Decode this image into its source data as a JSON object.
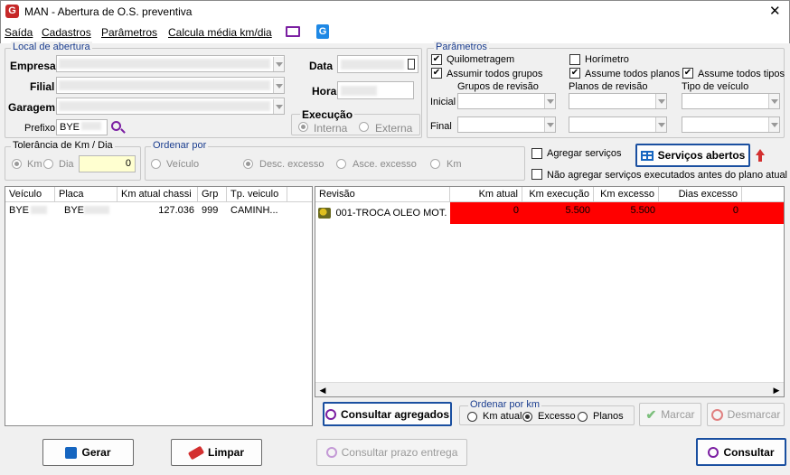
{
  "window": {
    "title": "MAN - Abertura de O.S. preventiva",
    "close": "✕"
  },
  "menu": {
    "items": [
      "Saída",
      "Cadastros",
      "Parâmetros",
      "Calcula média km/dia"
    ]
  },
  "local": {
    "legend": "Local de abertura",
    "empresa": "Empresa",
    "filial": "Filial",
    "garagem": "Garagem",
    "prefixo": "Prefixo",
    "prefixo_value": "BYE",
    "data": "Data",
    "hora": "Hora"
  },
  "execucao": {
    "legend": "Execução",
    "interna": "Interna",
    "externa": "Externa"
  },
  "params": {
    "legend": "Parâmetros",
    "quilometragem": "Quilometragem",
    "horimetro": "Horímetro",
    "assumir_grupos": "Assumir todos grupos",
    "assume_planos": "Assume todos planos",
    "assume_tipos": "Assume todos tipos",
    "grupos": "Grupos de revisão",
    "planos": "Planos de revisão",
    "tipo": "Tipo de veículo",
    "inicial": "Inicial",
    "final": "Final"
  },
  "tolerancia": {
    "legend": "Tolerância de Km / Dia",
    "km": "Km",
    "dia": "Dia",
    "value": "0"
  },
  "ordenar": {
    "legend": "Ordenar por",
    "veiculo": "Veículo",
    "desc": "Desc. excesso",
    "asce": "Asce. excesso",
    "km": "Km"
  },
  "agregar": {
    "agregar": "Agregar serviços",
    "nao_agregar": "Não agregar serviços executados antes do plano atual",
    "servicos_btn": "Serviços abertos"
  },
  "left_grid": {
    "headers": [
      "Veículo",
      "Placa",
      "Km atual chassi",
      "Grp",
      "Tp. veiculo"
    ],
    "rows": [
      [
        "BYE",
        "BYE",
        "127.036",
        "999",
        "CAMINH..."
      ]
    ]
  },
  "right_grid": {
    "headers": [
      "Revisão",
      "Km atual",
      "Km execução",
      "Km excesso",
      "Dias excesso"
    ],
    "rows": [
      [
        "001-TROCA OLEO MOT...",
        "0",
        "5.500",
        "5.500",
        "0"
      ]
    ],
    "highlight": "#ff0000"
  },
  "ordkm": {
    "legend": "Ordenar por km",
    "atual": "Km atual",
    "excesso": "Excesso",
    "planos": "Planos"
  },
  "buttons": {
    "consultar_agregados": "Consultar agregados",
    "marcar": "Marcar",
    "desmarcar": "Desmarcar",
    "gerar": "Gerar",
    "limpar": "Limpar",
    "consultar_prazo": "Consultar prazo entrega",
    "consultar": "Consultar"
  }
}
